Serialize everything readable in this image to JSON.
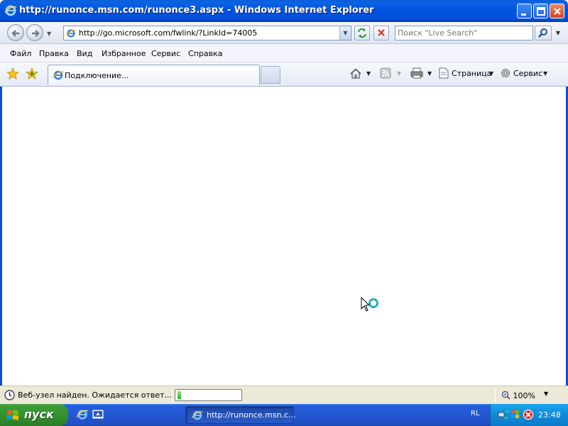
{
  "window": {
    "title": "http://runonce.msn.com/runonce3.aspx - Windows Internet Explorer"
  },
  "address_bar": {
    "url": "http://go.microsoft.com/fwlink/?LinkId=74005"
  },
  "search": {
    "placeholder": "Поиск \"Live Search\""
  },
  "menu": {
    "items": [
      "Файл",
      "Правка",
      "Вид",
      "Избранное",
      "Сервис",
      "Справка"
    ]
  },
  "tabs": {
    "active_label": "Подключение..."
  },
  "commands": {
    "page_label": "Страница",
    "tools_label": "Сервис"
  },
  "status_bar": {
    "text": "Веб-узел найден. Ожидается ответ...",
    "progress": 0.06,
    "zoom": "100%"
  },
  "taskbar": {
    "start_label": "пуск",
    "window_button_label": "http://runonce.msn.c...",
    "language": "RL",
    "clock": "23:48"
  },
  "colors": {
    "titlebar": "#0054e3",
    "taskbar": "#245edb",
    "start_button": "#3c9d37",
    "tray": "#0f8ad9"
  }
}
